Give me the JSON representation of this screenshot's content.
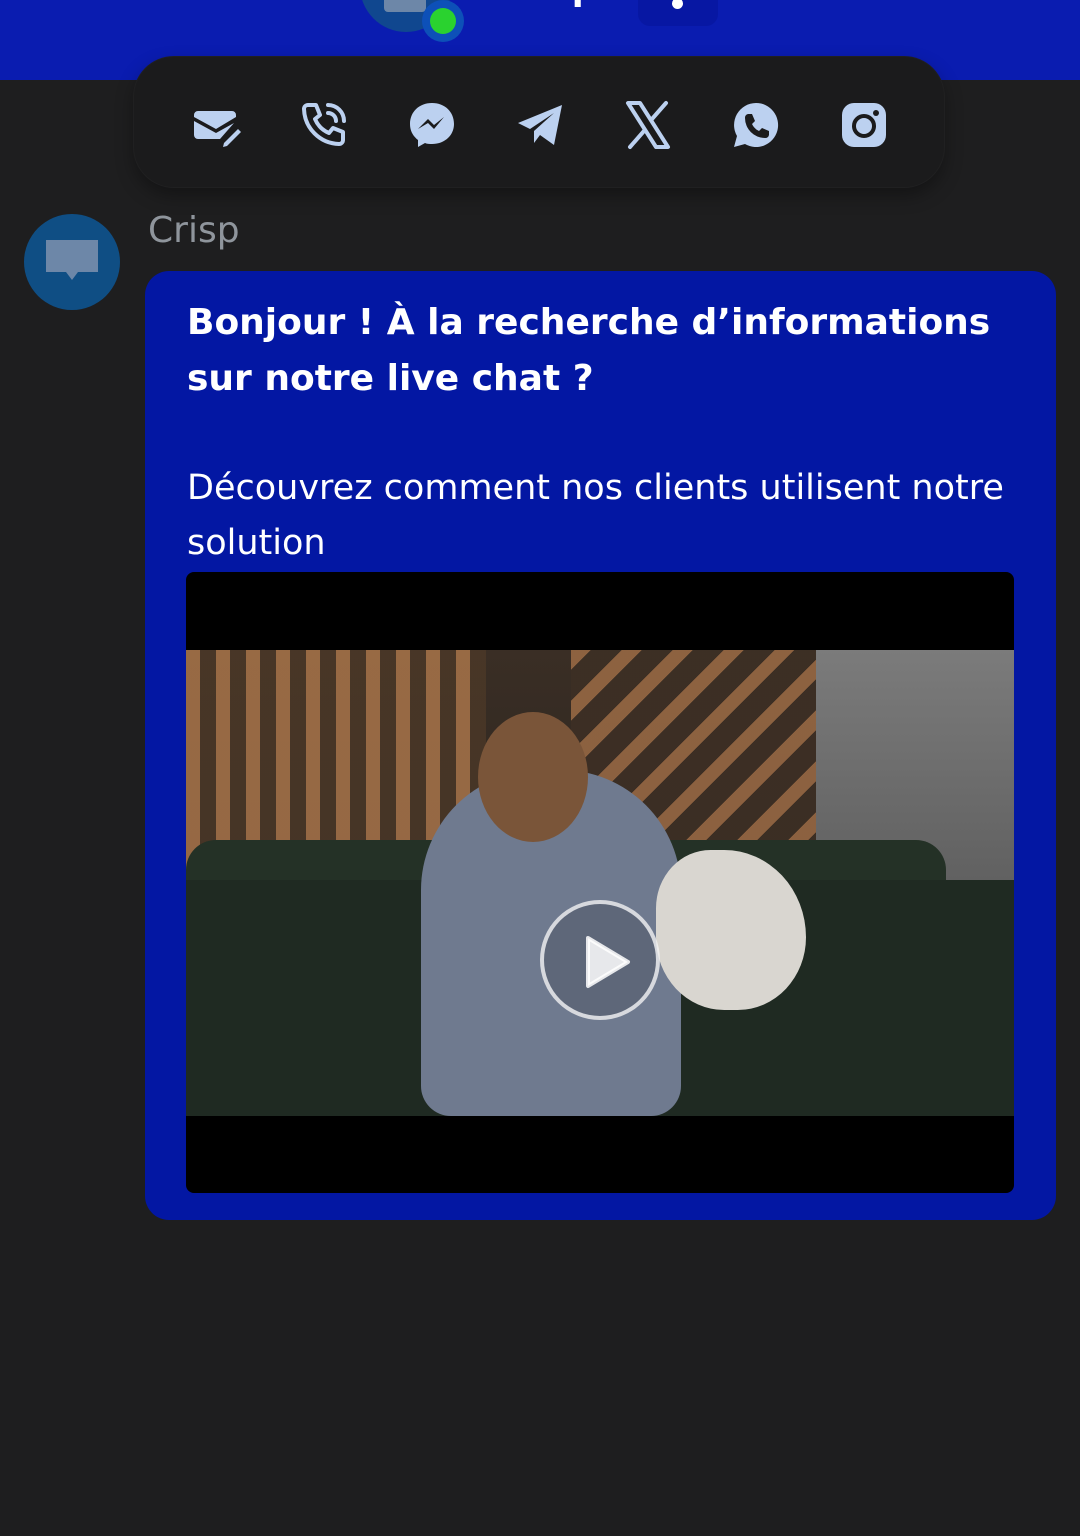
{
  "header": {
    "title": "Crisp",
    "status": "online"
  },
  "channels": [
    {
      "name": "email",
      "icon": "email-icon"
    },
    {
      "name": "phone",
      "icon": "phone-icon"
    },
    {
      "name": "messenger",
      "icon": "messenger-icon"
    },
    {
      "name": "telegram",
      "icon": "telegram-icon"
    },
    {
      "name": "x",
      "icon": "x-icon"
    },
    {
      "name": "whatsapp",
      "icon": "whatsapp-icon"
    },
    {
      "name": "instagram",
      "icon": "instagram-icon"
    }
  ],
  "message": {
    "sender": "Crisp",
    "greeting": "Bonjour ! À la recherche d’informations sur notre live chat ?",
    "body": "Découvrez comment nos clients utilisent notre solution"
  },
  "colors": {
    "brand_blue": "#0317a3",
    "background": "#1e1e1f",
    "icon_color": "#bcd1f0",
    "status_green": "#2ad22f"
  }
}
